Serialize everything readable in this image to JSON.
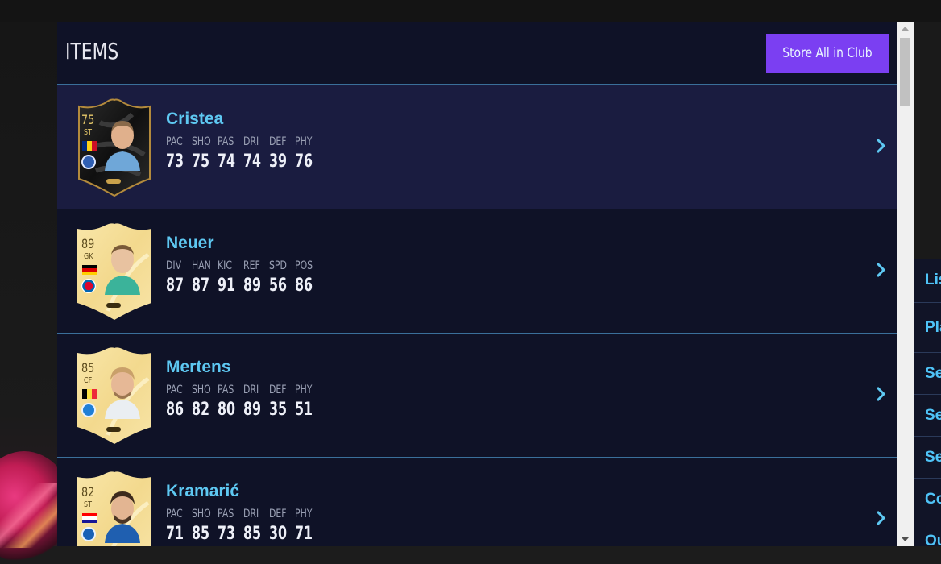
{
  "header": {
    "title": "ITEMS",
    "store_all_label": "Store All in Club"
  },
  "side_menu": {
    "items": [
      "Lis",
      "Pla",
      "Se",
      "Se",
      "Se",
      "Co",
      "Ou"
    ]
  },
  "items": [
    {
      "name": "Cristea",
      "rating": "75",
      "position": "ST",
      "card_type": "tots",
      "stat_labels": [
        "PAC",
        "SHO",
        "PAS",
        "DRI",
        "DEF",
        "PHY"
      ],
      "stat_values": [
        "73",
        "75",
        "74",
        "74",
        "39",
        "76"
      ]
    },
    {
      "name": "Neuer",
      "rating": "89",
      "position": "GK",
      "card_type": "gold",
      "stat_labels": [
        "DIV",
        "HAN",
        "KIC",
        "REF",
        "SPD",
        "POS"
      ],
      "stat_values": [
        "87",
        "87",
        "91",
        "89",
        "56",
        "86"
      ]
    },
    {
      "name": "Mertens",
      "rating": "85",
      "position": "CF",
      "card_type": "gold",
      "stat_labels": [
        "PAC",
        "SHO",
        "PAS",
        "DRI",
        "DEF",
        "PHY"
      ],
      "stat_values": [
        "86",
        "82",
        "80",
        "89",
        "35",
        "51"
      ]
    },
    {
      "name": "Kramarić",
      "rating": "82",
      "position": "ST",
      "card_type": "gold",
      "stat_labels": [
        "PAC",
        "SHO",
        "PAS",
        "DRI",
        "DEF",
        "PHY"
      ],
      "stat_values": [
        "71",
        "85",
        "73",
        "85",
        "30",
        "71"
      ]
    }
  ],
  "colors": {
    "accent_button": "#7b3ff2",
    "player_name": "#5ec8f2",
    "panel_bg": "#0f1227",
    "selected_row_bg": "#1a1c40"
  },
  "icons": {
    "row_action": "chevron-right-icon",
    "scroll_up": "arrow-up-icon",
    "scroll_down": "arrow-down-icon"
  }
}
